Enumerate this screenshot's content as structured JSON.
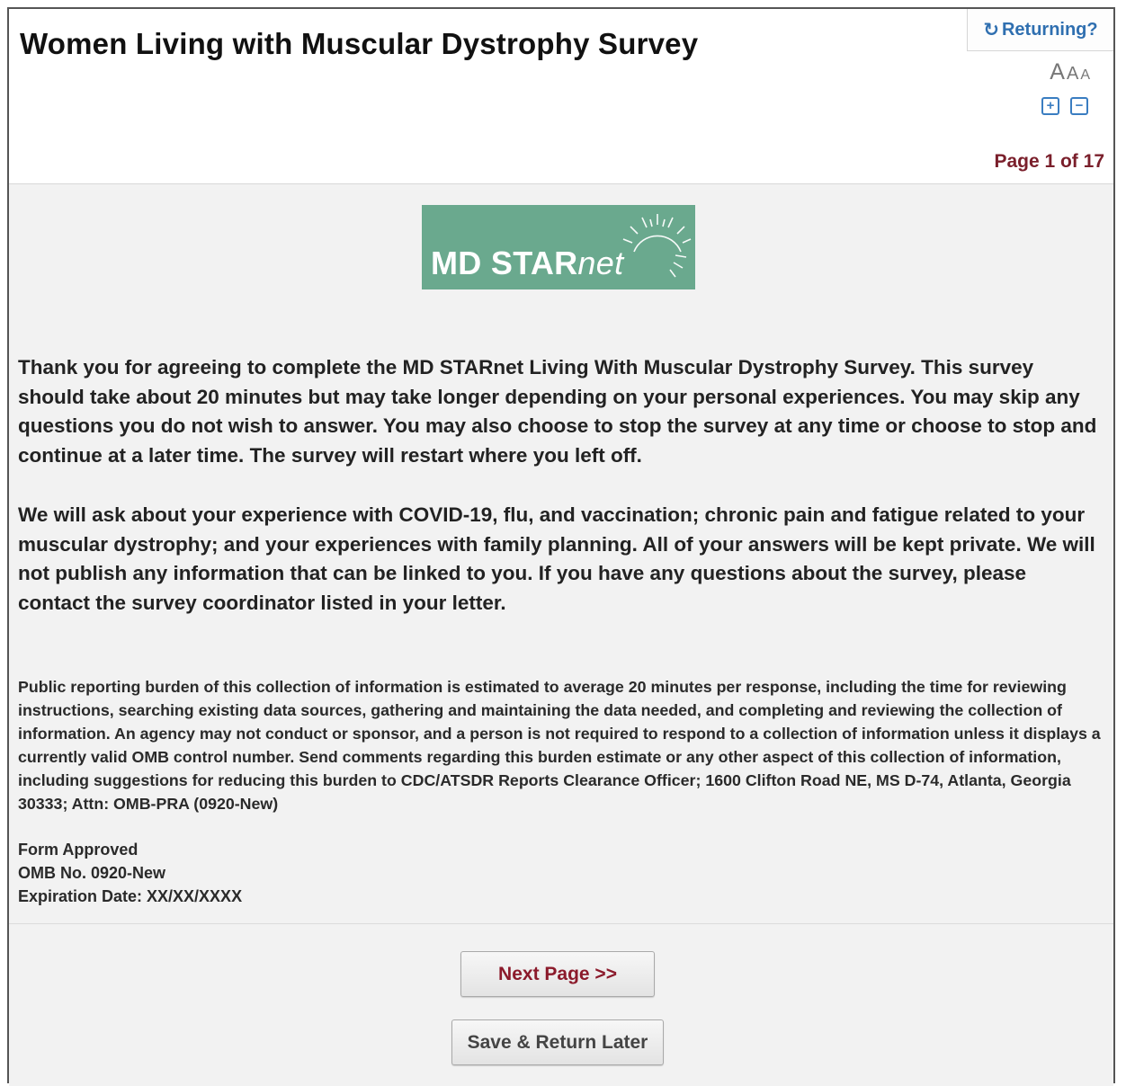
{
  "header": {
    "title": "Women Living with Muscular Dystrophy Survey",
    "returning_label": "Returning?",
    "font_size_letters": [
      "A",
      "A",
      "A"
    ],
    "zoom_in_symbol": "+",
    "zoom_out_symbol": "−",
    "page_indicator": "Page 1 of 17"
  },
  "logo": {
    "main_text": "MD STAR",
    "italic_text": "net",
    "background_color": "#6aa98e"
  },
  "body": {
    "paragraph_1": "Thank you for agreeing to complete the MD STARnet Living With Muscular Dystrophy Survey. This survey should take about 20 minutes but may take longer depending on your personal experiences. You may skip any questions you do not wish to answer. You may also choose to stop the survey at any time or choose to stop and continue at a later time. The survey will restart where you left off.",
    "paragraph_2": "We will ask about your experience with COVID-19, flu, and vaccination; chronic pain and fatigue related to your muscular dystrophy; and your experiences with family planning. All of your answers will be kept private. We will not publish any information that can be linked to you. If you have any questions about the survey, please contact the survey coordinator listed in your letter.",
    "burden_statement": "Public reporting burden of this collection of information is estimated to average 20 minutes per response, including the time for reviewing instructions, searching existing data sources, gathering and maintaining the data needed, and completing and reviewing the collection of information. An agency may not conduct or sponsor, and a person is not required to respond to a collection of information unless it displays a currently valid OMB control number. Send comments regarding this burden estimate or any other aspect of this collection of information, including suggestions for reducing this burden to CDC/ATSDR Reports Clearance Officer; 1600 Clifton Road NE, MS D-74, Atlanta, Georgia 30333; Attn: OMB-PRA (0920-New)",
    "form_approved": "Form Approved",
    "omb_number": "OMB No. 0920-New",
    "expiration": "Expiration Date: XX/XX/XXXX"
  },
  "footer": {
    "next_label": "Next Page >>",
    "save_label": "Save & Return Later"
  },
  "colors": {
    "page_indicator": "#7a1f2b",
    "next_button_text": "#8b1a2b",
    "link_blue": "#2f6fb0",
    "content_background": "#f2f2f2"
  },
  "icons": {
    "returning": "refresh-icon",
    "zoom_in": "plus-square-icon",
    "zoom_out": "minus-square-icon"
  }
}
